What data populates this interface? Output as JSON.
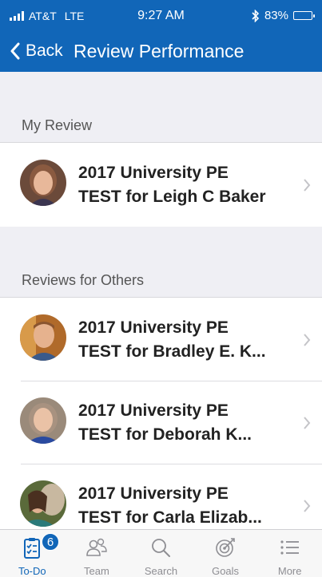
{
  "status_bar": {
    "carrier": "AT&T",
    "network": "LTE",
    "time": "9:27 AM",
    "battery": "83%",
    "battery_level": 0.83
  },
  "nav": {
    "back_label": "Back",
    "title": "Review Performance"
  },
  "sections": {
    "my_review": {
      "header": "My Review",
      "items": [
        {
          "line1": "2017 University PE",
          "line2": "TEST for Leigh C Baker"
        }
      ]
    },
    "others": {
      "header": "Reviews for Others",
      "items": [
        {
          "line1": "2017 University PE",
          "line2": "TEST for Bradley E. K..."
        },
        {
          "line1": "2017 University PE",
          "line2": "TEST for Deborah K..."
        },
        {
          "line1": "2017 University PE",
          "line2": "TEST for Carla Elizab..."
        }
      ]
    }
  },
  "tabs": [
    {
      "label": "To-Do",
      "icon": "clipboard-checklist-icon",
      "badge": "6",
      "active": true
    },
    {
      "label": "Team",
      "icon": "team-people-icon"
    },
    {
      "label": "Search",
      "icon": "search-icon"
    },
    {
      "label": "Goals",
      "icon": "target-icon"
    },
    {
      "label": "More",
      "icon": "list-menu-icon"
    }
  ],
  "colors": {
    "brand_blue": "#1166b8",
    "background_gray": "#efeff4",
    "tab_inactive": "#8e8e93"
  }
}
